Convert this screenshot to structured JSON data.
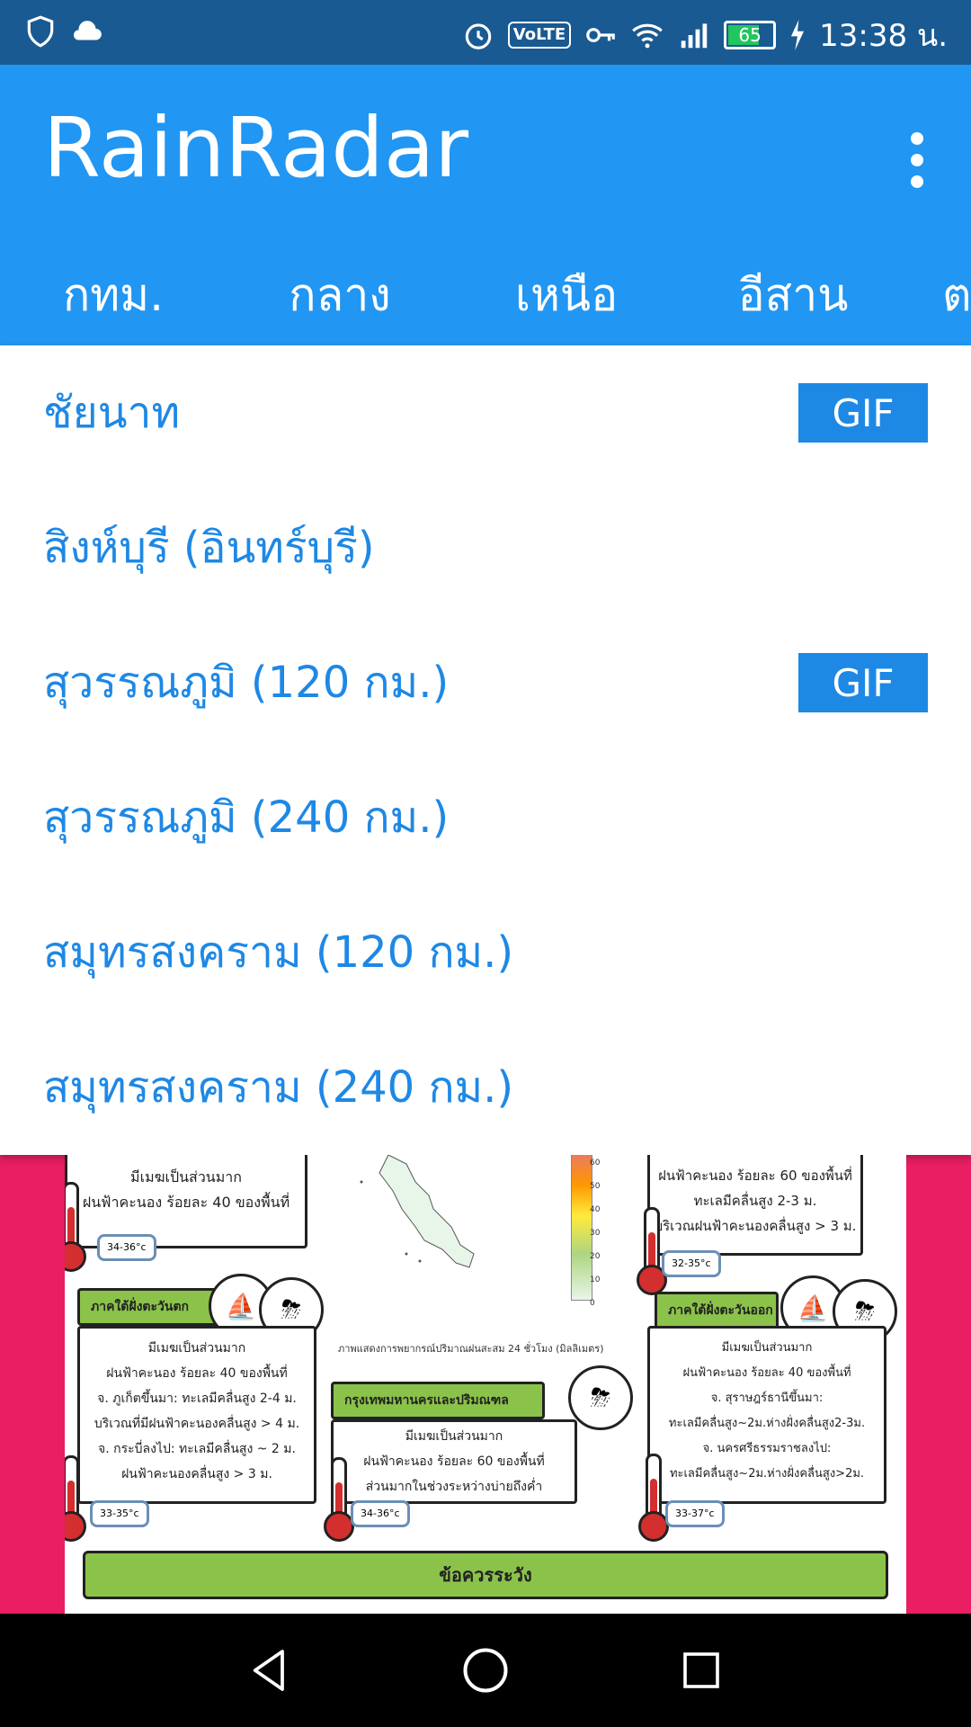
{
  "status_bar": {
    "time": "13:38 น.",
    "battery": "65",
    "volte": "VoLTE",
    "icons": [
      "shield-icon",
      "cloud-icon",
      "alarm-icon",
      "volte-icon",
      "key-icon",
      "wifi-icon",
      "signal-icon",
      "battery-icon",
      "charging-icon"
    ]
  },
  "app": {
    "title": "RainRadar"
  },
  "tabs": [
    "กทม.",
    "กลาง",
    "เหนือ",
    "อีสาน",
    "ตะ"
  ],
  "radar_list": [
    {
      "label": "ชัยนาท",
      "gif": "GIF"
    },
    {
      "label": "สิงห์บุรี (อินทร์บุรี)",
      "gif": null
    },
    {
      "label": "สุวรรณภูมิ (120 กม.)",
      "gif": "GIF"
    },
    {
      "label": "สุวรรณภูมิ (240 กม.)",
      "gif": null
    },
    {
      "label": "สมุทรสงคราม (120 กม.)",
      "gif": null
    },
    {
      "label": "สมุทรสงคราม (240 กม.)",
      "gif": null
    }
  ],
  "infographic": {
    "top_left_card": [
      "มีเมฆเป็นส่วนมาก",
      "ฝนฟ้าคะนอง ร้อยละ 40 ของพื้นที่"
    ],
    "top_left_temp": "34-36°c",
    "top_right_card": [
      "ฝนฟ้าคะนอง ร้อยละ 60 ของพื้นที่",
      "ทะเลมีคลื่นสูง 2-3 ม.",
      "บริเวณฝนฟ้าคะนองคลื่นสูง > 3 ม."
    ],
    "top_right_temp": "32-35°c",
    "scale_ticks": [
      "60",
      "50",
      "40",
      "30",
      "20",
      "10",
      "0"
    ],
    "map_caption": "ภาพแสดงการพยากรณ์ปริมาณฝนสะสม 24 ชั่วโมง (มิลลิเมตร)",
    "west_head": "ภาคใต้ฝั่งตะวันตก",
    "west_card": [
      "มีเมฆเป็นส่วนมาก",
      "ฝนฟ้าคะนอง ร้อยละ 40 ของพื้นที่",
      "จ. ภูเก็ตขึ้นมา: ทะเลมีคลื่นสูง 2-4 ม.",
      "บริเวณที่มีฝนฟ้าคะนองคลื่นสูง > 4 ม.",
      "จ. กระบี่ลงไป: ทะเลมีคลื่นสูง ~ 2 ม.",
      "ฝนฟ้าคะนองคลื่นสูง > 3 ม."
    ],
    "west_temp": "33-35°c",
    "bkk_head": "กรุงเทพมหานครและปริมณฑล",
    "bkk_card": [
      "มีเมฆเป็นส่วนมาก",
      "ฝนฟ้าคะนอง ร้อยละ 60 ของพื้นที่",
      "ส่วนมากในช่วงระหว่างบ่ายถึงค่ำ"
    ],
    "bkk_temp": "34-36°c",
    "east_head": "ภาคใต้ฝั่งตะวันออก",
    "east_card": [
      "มีเมฆเป็นส่วนมาก",
      "ฝนฟ้าคะนอง ร้อยละ 40 ของพื้นที่",
      "จ. สุราษฎร์ธานีขึ้นมา:",
      "ทะเลมีคลื่นสูง~2ม.ห่างฝั่งคลื่นสูง2-3ม.",
      "จ. นครศรีธรรมราชลงไป:",
      "ทะเลมีคลื่นสูง~2ม.ห่างฝั่งคลื่นสูง>2ม."
    ],
    "east_temp": "33-37°c",
    "warning_title": "ข้อควรระวัง"
  },
  "colors": {
    "status_bar": "#195a92",
    "app_bar": "#2196f3",
    "accent": "#1e88e5",
    "background": "#e91e63",
    "card_header": "#8bc34a"
  }
}
